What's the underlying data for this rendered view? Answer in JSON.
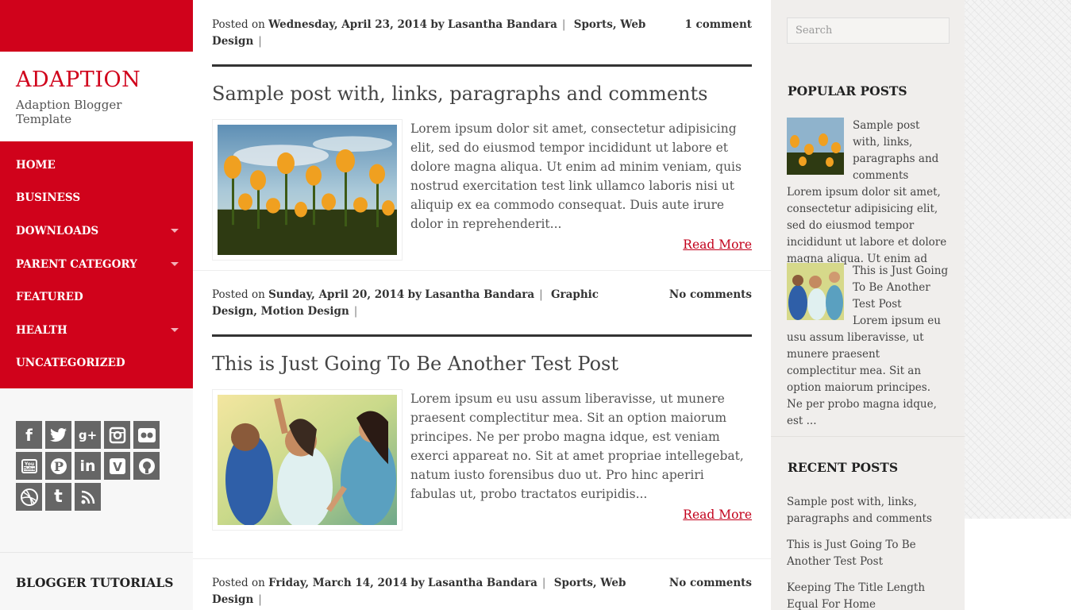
{
  "site": {
    "title": "ADAPTION",
    "tagline": "Adaption Blogger Template"
  },
  "nav": {
    "items": [
      {
        "label": "HOME",
        "has_submenu": false
      },
      {
        "label": "BUSINESS",
        "has_submenu": false
      },
      {
        "label": "DOWNLOADS",
        "has_submenu": true
      },
      {
        "label": "PARENT CATEGORY",
        "has_submenu": true
      },
      {
        "label": "FEATURED",
        "has_submenu": false
      },
      {
        "label": "HEALTH",
        "has_submenu": true
      },
      {
        "label": "UNCATEGORIZED",
        "has_submenu": false
      }
    ]
  },
  "social": {
    "icons": [
      "facebook-icon",
      "twitter-icon",
      "google-plus-icon",
      "instagram-icon",
      "flickr-icon",
      "youtube-icon",
      "pinterest-icon",
      "linkedin-icon",
      "vimeo-icon",
      "github-icon",
      "dribbble-icon",
      "tumblr-icon",
      "rss-icon"
    ],
    "glyphs": [
      "f",
      "🐦",
      "g+",
      "◙",
      "●●",
      "You Tube",
      "P",
      "in",
      "V",
      "◉",
      "⊛",
      "t",
      "))"
    ]
  },
  "sidebar_left": {
    "widget_title": "BLOGGER TUTORIALS"
  },
  "posts": [
    {
      "posted_on": "Posted on",
      "date": "Wednesday, April 23, 2014",
      "by": "by",
      "author": "Lasantha Bandara",
      "categories": "Sports, Web Design",
      "comments": "1 comment",
      "title": "Sample post with, links, paragraphs and comments",
      "excerpt": "Lorem ipsum dolor sit amet, consectetur adipisicing elit, sed do eiusmod tempor incididunt ut labore et dolore magna aliqua. Ut enim ad minim veniam, quis nostrud exercitation test link ullamco laboris nisi ut aliquip ex ea commodo consequat. Duis aute irure dolor in reprehenderit...",
      "read_more": "Read More"
    },
    {
      "posted_on": "Posted on",
      "date": "Sunday, April 20, 2014",
      "by": "by",
      "author": "Lasantha Bandara",
      "categories": "Graphic Design, Motion Design",
      "comments": "No comments",
      "title": "This is Just Going To Be Another Test Post",
      "excerpt": "Lorem ipsum eu usu assum liberavisse, ut munere praesent complectitur mea. Sit an option maiorum principes. Ne per probo magna idque, est veniam exerci appareat no. Sit at amet propriae intellegebat, natum iusto forensibus duo ut. Pro hinc aperiri fabulas ut, probo tractatos euripidis...",
      "read_more": "Read More"
    },
    {
      "posted_on": "Posted on",
      "date": "Friday, March 14, 2014",
      "by": "by",
      "author": "Lasantha Bandara",
      "categories": "Sports, Web Design",
      "comments": "No comments"
    }
  ],
  "search": {
    "placeholder": "Search"
  },
  "popular_posts": {
    "title": "POPULAR POSTS",
    "items": [
      {
        "title": "Sample post with, links, paragraphs and comments",
        "snippet": "Lorem ipsum dolor sit amet, consectetur adipisicing elit, sed do eiusmod tempor incididunt ut labore et dolore magna aliqua. Ut enim ad m..."
      },
      {
        "title": "This is Just Going To Be Another Test Post",
        "snippet": "Lorem ipsum eu usu assum liberavisse, ut munere praesent complectitur mea. Sit an option maiorum principes. Ne per probo magna idque, est ..."
      }
    ]
  },
  "recent_posts": {
    "title": "RECENT POSTS",
    "items": [
      "Sample post with, links, paragraphs and comments",
      "This is Just Going To Be Another Test Post",
      "Keeping The Title Length Equal For Home"
    ]
  },
  "colors": {
    "brand_red": "#d0021b",
    "link_red": "#c2001b",
    "sidebar_bg": "#f0eeec"
  }
}
